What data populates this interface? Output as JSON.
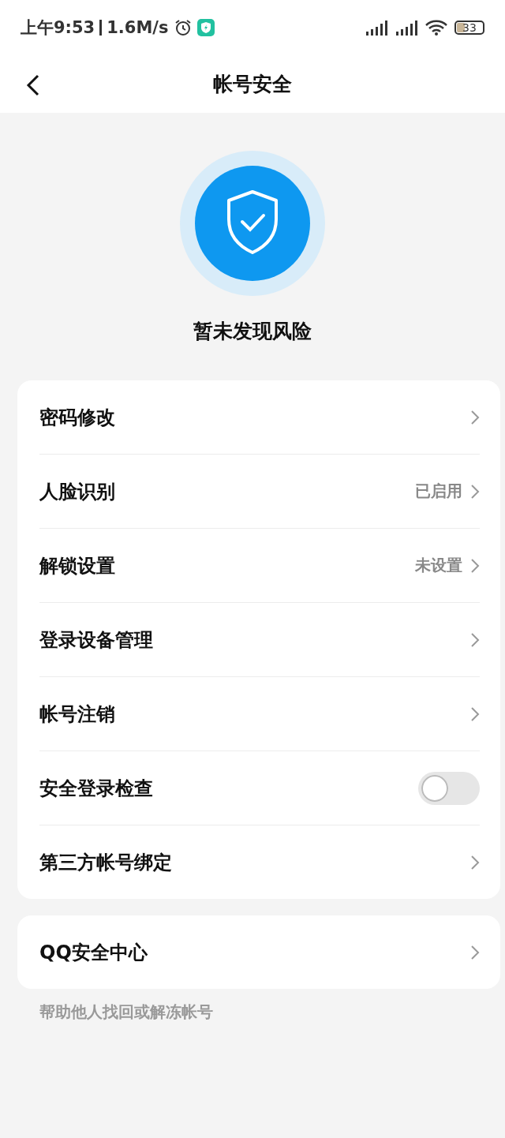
{
  "status_bar": {
    "time": "上午9:53",
    "speed": "1.6M/s",
    "battery": "33"
  },
  "header": {
    "title": "帐号安全"
  },
  "security": {
    "status": "暂未发现风险"
  },
  "settings": [
    {
      "kind": "link",
      "label": "密码修改"
    },
    {
      "kind": "link",
      "label": "人脸识别",
      "value": "已启用"
    },
    {
      "kind": "link",
      "label": "解锁设置",
      "value": "未设置"
    },
    {
      "kind": "link",
      "label": "登录设备管理"
    },
    {
      "kind": "link",
      "label": "帐号注销"
    },
    {
      "kind": "toggle",
      "label": "安全登录检查",
      "on": false
    },
    {
      "kind": "link",
      "label": "第三方帐号绑定"
    }
  ],
  "qq_section": {
    "items": [
      {
        "kind": "link",
        "label": "QQ安全中心"
      }
    ],
    "footer": "帮助他人找回或解冻帐号"
  }
}
